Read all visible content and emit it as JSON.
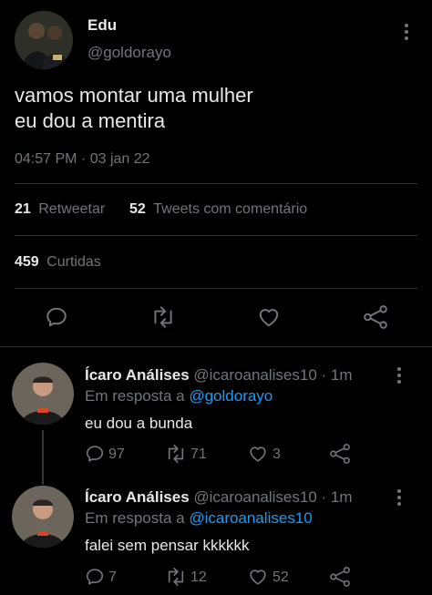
{
  "tweet": {
    "author_name": "Edu",
    "author_handle": "@goldorayo",
    "text_line1": "vamos montar uma mulher",
    "text_line2": "eu dou a mentira",
    "timestamp": "04:57 PM · 03 jan 22",
    "retweet_count": "21",
    "retweet_label": "Retweetar",
    "quote_count": "52",
    "quote_label": "Tweets com comentário",
    "like_count": "459",
    "like_label": "Curtidas"
  },
  "replies": [
    {
      "name": "Ícaro Análises",
      "handle": "@icaroanalises10",
      "time": "· 1m",
      "reply_prefix": "Em resposta a",
      "reply_to": "@goldorayo",
      "text": "eu dou a bunda",
      "replies": "97",
      "retweets": "71",
      "likes": "3"
    },
    {
      "name": "Ícaro Análises",
      "handle": "@icaroanalises10",
      "time": "· 1m",
      "reply_prefix": "Em resposta a",
      "reply_to": "@icaroanalises10",
      "text": "falei sem pensar kkkkkk",
      "replies": "7",
      "retweets": "12",
      "likes": "52"
    }
  ],
  "icons": [
    "more-icon",
    "reply-icon",
    "retweet-icon",
    "like-icon",
    "share-icon"
  ],
  "colors": {
    "background": "#000000",
    "text": "#e7e9ea",
    "muted": "#71767b",
    "link": "#1d9bf0",
    "divider": "#2f3336"
  }
}
